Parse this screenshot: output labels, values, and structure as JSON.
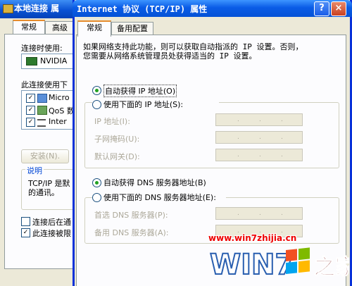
{
  "back_window": {
    "title": "本地连接 属",
    "tabs": [
      "常规",
      "高级"
    ],
    "connect_using_label": "连接时使用:",
    "adapter_name": "NVIDIA",
    "items_label": "此连接使用下",
    "items": [
      "Micro",
      "QoS 数",
      "Inter"
    ],
    "install_button": "安装(N).",
    "description_group": "说明",
    "description_text_1": "TCP/IP 是默",
    "description_text_2": "的通讯。",
    "checkbox_1": "连接后在通",
    "checkbox_2": "此连接被限"
  },
  "dialog": {
    "title": "Internet 协议 (TCP/IP) 属性",
    "help_glyph": "?",
    "close_glyph": "×",
    "tabs": [
      "常规",
      "备用配置"
    ],
    "description_line1": "如果网络支持此功能，则可以获取自动指派的 IP 设置。否则，",
    "description_line2": "您需要从网络系统管理员处获得适当的 IP 设置。",
    "auto_ip_label": "自动获得 IP 地址(O)",
    "manual_ip_label": "使用下面的 IP 地址(S):",
    "ip_address_label": "IP 地址(I):",
    "subnet_label": "子网掩码(U):",
    "gateway_label": "默认网关(D):",
    "auto_dns_label": "自动获得 DNS 服务器地址(B)",
    "manual_dns_label": "使用下面的 DNS 服务器地址(E):",
    "preferred_dns_label": "首选 DNS 服务器(P):",
    "alternate_dns_label": "备用 DNS 服务器(A):",
    "ip_dot": "."
  },
  "watermark": {
    "url": "www.win7zhijia.cn",
    "logo_text": "WIN7",
    "logo_suffix": "之家"
  },
  "colors": {
    "titlebar": "#0a5ce6",
    "radio_selected": "#21a121",
    "tab_highlight": "#e68b2c",
    "watermark": "#e00000"
  }
}
